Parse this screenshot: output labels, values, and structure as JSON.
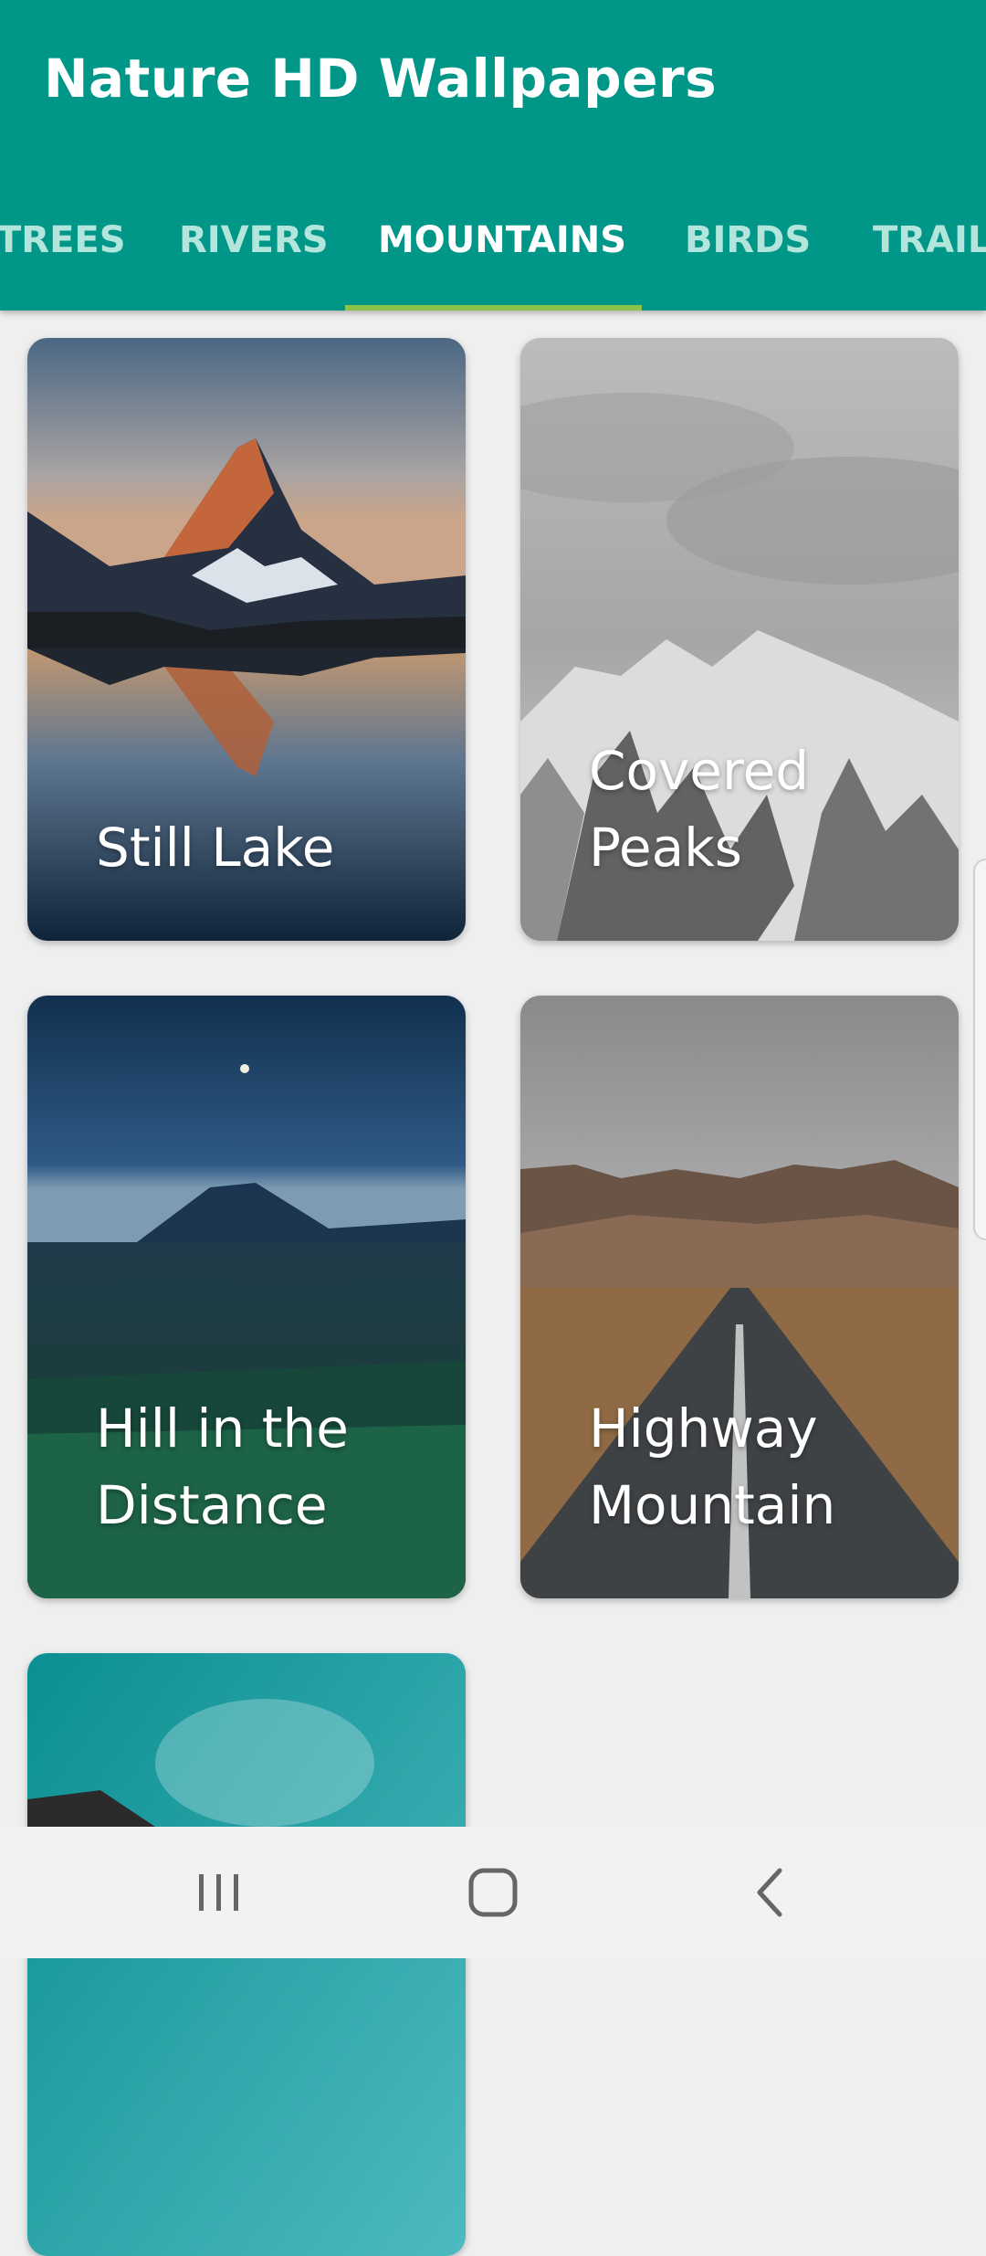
{
  "app": {
    "title": "Nature HD Wallpapers"
  },
  "tabs": [
    {
      "label": "TREES",
      "active": false
    },
    {
      "label": "RIVERS",
      "active": false
    },
    {
      "label": "MOUNTAINS",
      "active": true
    },
    {
      "label": "BIRDS",
      "active": false
    },
    {
      "label": "TRAILS",
      "active": false
    }
  ],
  "colors": {
    "appbar": "#009688",
    "accent": "#8bc34a",
    "background": "#efefef"
  },
  "cards": [
    {
      "title": "Still Lake"
    },
    {
      "title": "Covered Peaks"
    },
    {
      "title": "Hill in the Distance"
    },
    {
      "title": "Highway Mountain"
    },
    {
      "title": ""
    }
  ],
  "navbar": {
    "icons": [
      "recent-apps-icon",
      "home-icon",
      "back-icon"
    ]
  }
}
